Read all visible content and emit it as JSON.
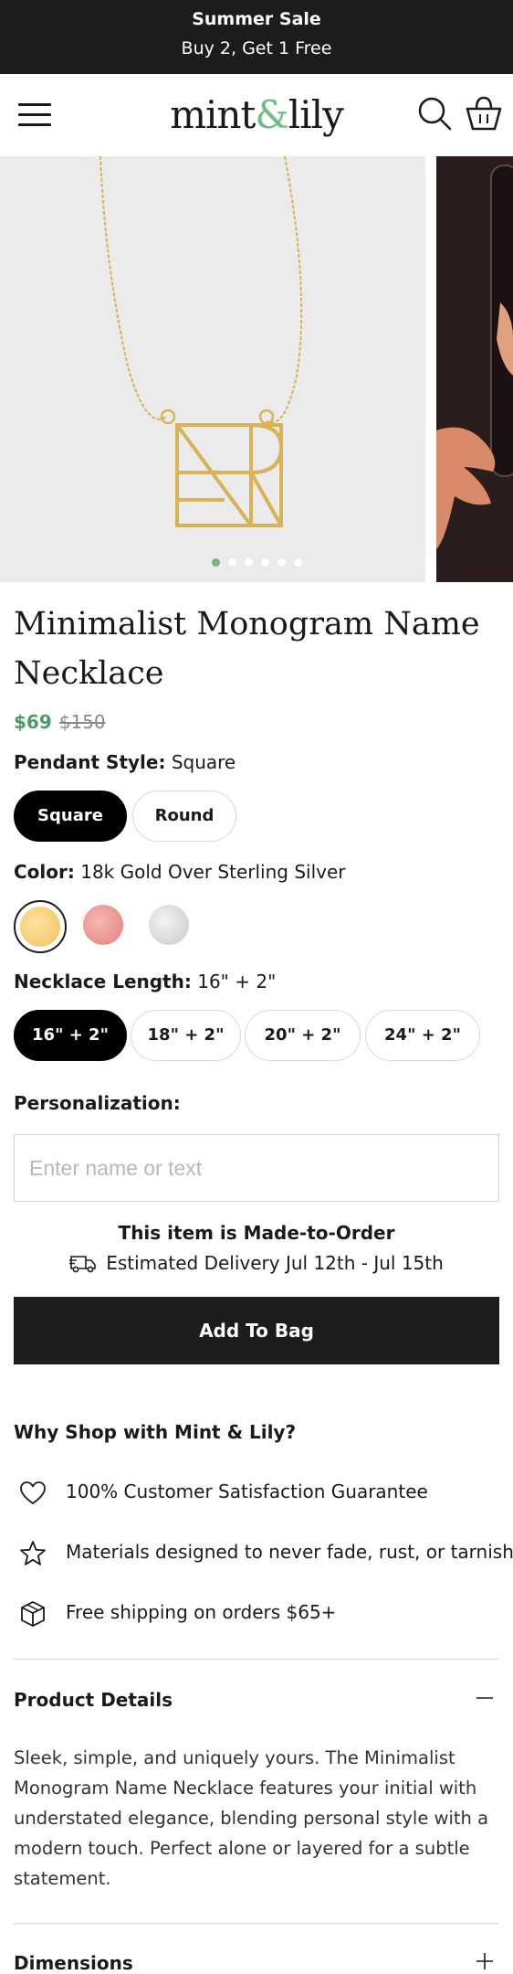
{
  "promo": {
    "title": "Summer Sale",
    "subtitle": "Buy 2, Get 1 Free"
  },
  "header": {
    "logo_part1": "mint",
    "logo_amp": "&",
    "logo_part2": "lily",
    "icons": [
      "menu-icon",
      "search-icon",
      "shopping-bag-icon"
    ]
  },
  "gallery": {
    "slide_count": 6,
    "active_index": 0
  },
  "product": {
    "title": "Minimalist Monogram Name Necklace",
    "price": "$69",
    "compare_price": "$150"
  },
  "options": {
    "pendant": {
      "label": "Pendant Style:",
      "value": "Square",
      "choices": [
        "Square",
        "Round"
      ],
      "selected": "Square"
    },
    "color": {
      "label": "Color:",
      "value": "18k Gold Over Sterling Silver",
      "swatches": [
        {
          "name": "gold",
          "color": "#f5c96a"
        },
        {
          "name": "rose-gold",
          "color": "#e9928f"
        },
        {
          "name": "silver",
          "color": "#d4d4d4"
        }
      ],
      "selected": "gold"
    },
    "length": {
      "label": "Necklace Length:",
      "value": "16\" + 2\"",
      "choices": [
        "16\" + 2\"",
        "18\" + 2\"",
        "20\" + 2\"",
        "24\" + 2\""
      ],
      "selected": "16\" + 2\""
    },
    "personalization": {
      "label": "Personalization:",
      "placeholder": "Enter name or text",
      "value": ""
    }
  },
  "fulfillment": {
    "made_to_order": "This item is Made-to-Order",
    "delivery": "Estimated Delivery Jul 12th - Jul 15th"
  },
  "cta": {
    "add_to_bag": "Add To Bag"
  },
  "why": {
    "title": "Why Shop with Mint & Lily?",
    "items": [
      {
        "icon": "heart-icon",
        "text": "100% Customer Satisfaction Guarantee"
      },
      {
        "icon": "star-icon",
        "text": "Materials designed to never fade, rust, or tarnish."
      },
      {
        "icon": "box-icon",
        "text": "Free shipping on orders $65+"
      }
    ]
  },
  "accordion": {
    "details": {
      "label": "Product Details",
      "expanded": true,
      "body": "Sleek, simple, and uniquely yours. The Minimalist Monogram Name Necklace features your initial with understated elegance, blending personal style with a modern touch. Perfect alone or layered for a subtle statement."
    },
    "dimensions": {
      "label": "Dimensions",
      "expanded": false
    }
  },
  "colors": {
    "promo_bg": "#1c1c1c",
    "accent_green": "#4e9a63",
    "logo_amp": "#6fbd84",
    "dot_active": "#7fb08c"
  }
}
